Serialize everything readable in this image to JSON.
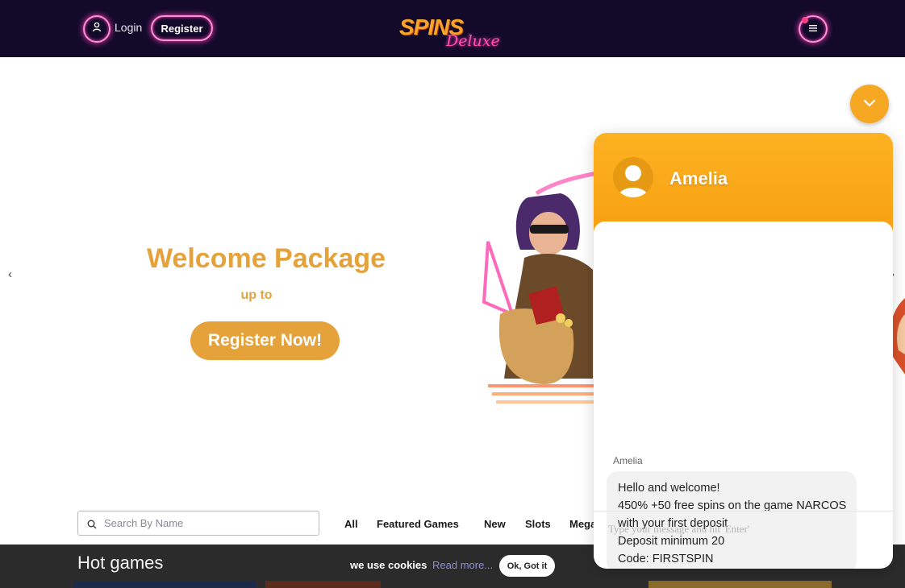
{
  "header": {
    "login_label": "Login",
    "register_label": "Register",
    "logo_main": "SPINS",
    "logo_sub": "Deluxe"
  },
  "hero": {
    "title": "Welcome Package",
    "subtitle": "up to",
    "cta_label": "Register Now!",
    "prev_arrow": "‹",
    "next_arrow": "›"
  },
  "search": {
    "placeholder": "Search By Name",
    "value": ""
  },
  "categories": [
    "All",
    "Featured Games",
    "New",
    "Slots",
    "Mega"
  ],
  "hot_games": {
    "title": "Hot games"
  },
  "cookie": {
    "text": "we use cookies",
    "link": "Read more...",
    "button": "Ok, Got it"
  },
  "chat": {
    "agent_name": "Amelia",
    "message_author": "Amelia",
    "message_lines": [
      "Hello and welcome!",
      "450% +50 free spins on the game NARCOS",
      "with your first deposit",
      "Deposit minimum 20",
      "Code: FIRSTSPIN"
    ],
    "input_placeholder": "Type your message and hit 'Enter'"
  },
  "colors": {
    "header_bg": "#130a2a",
    "brand_gold": "#e5a23a",
    "neon_pink": "#ff3fb8",
    "chat_orange": "#fdb222",
    "hot_bar_bg": "#2b2b2b"
  },
  "icons": {
    "user": "user-icon",
    "menu": "hamburger-menu-icon",
    "search": "search-icon",
    "chat_toggle": "chevron-down-icon",
    "chat_avatar": "person-avatar-icon"
  }
}
